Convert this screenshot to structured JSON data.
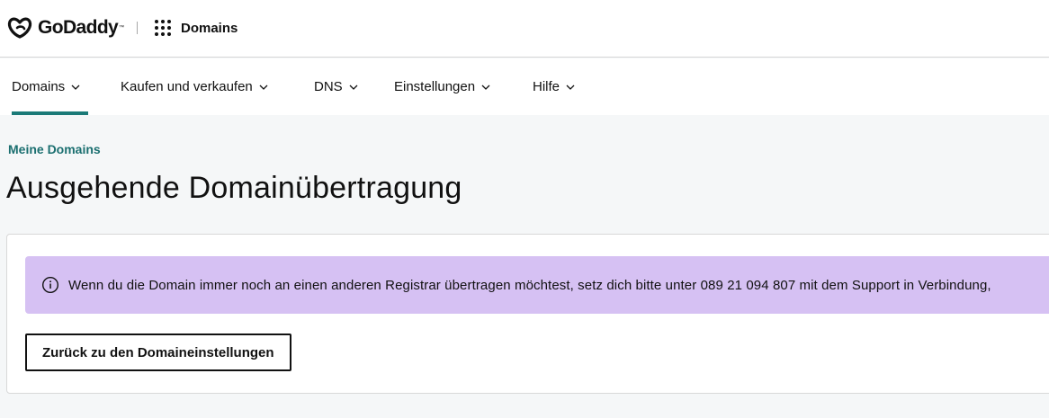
{
  "header": {
    "brand": "GoDaddy",
    "trademark": "™",
    "product": "Domains",
    "icons": {
      "logo": "godaddy-logo-icon",
      "apps": "apps-grid-icon"
    }
  },
  "nav": {
    "items": [
      {
        "label": "Domains",
        "active": true
      },
      {
        "label": "Kaufen und verkaufen",
        "active": false
      },
      {
        "label": "DNS",
        "active": false
      },
      {
        "label": "Einstellungen",
        "active": false
      },
      {
        "label": "Hilfe",
        "active": false
      }
    ],
    "chevron_icon": "chevron-down-icon"
  },
  "breadcrumb": "Meine Domains",
  "page_title": "Ausgehende Domainübertragung",
  "alert": {
    "icon": "info-icon",
    "text": "Wenn du die Domain immer noch an einen anderen Registrar übertragen möchtest, setz dich bitte unter 089 21 094 807 mit dem Support in Verbindung,"
  },
  "back_button_label": "Zurück zu den Domaineinstellungen",
  "colors": {
    "accent": "#1b7a78",
    "link": "#1b6f70",
    "alert_bg": "#d6c1f3",
    "page_bg": "#f5f7f8"
  }
}
